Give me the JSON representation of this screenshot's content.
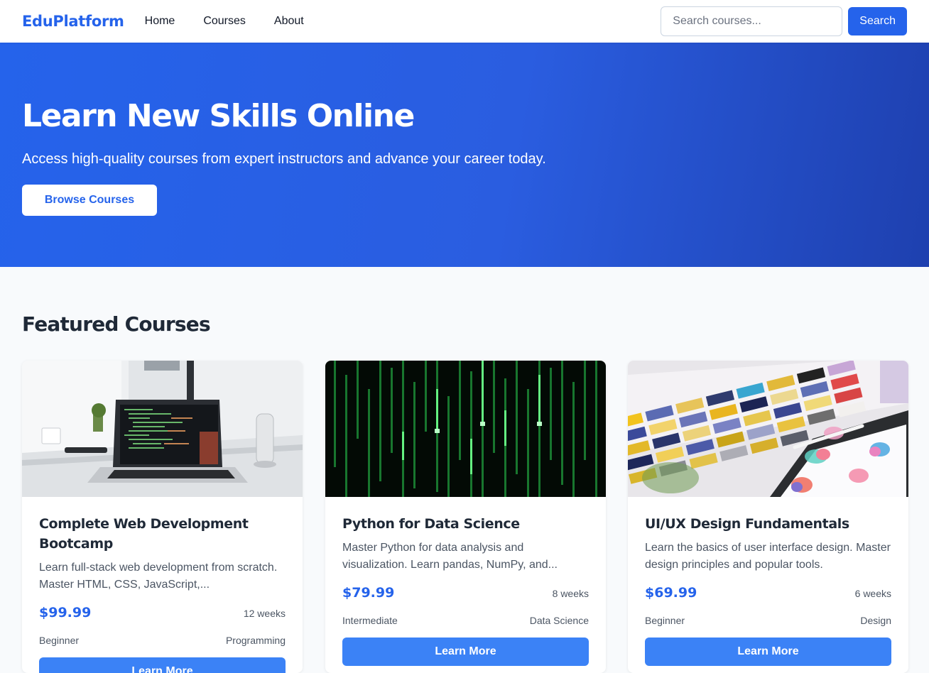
{
  "nav": {
    "logo": "EduPlatform",
    "links": [
      "Home",
      "Courses",
      "About"
    ],
    "search_placeholder": "Search courses...",
    "search_button": "Search"
  },
  "hero": {
    "title": "Learn New Skills Online",
    "subtitle": "Access high-quality courses from expert instructors and advance your career today.",
    "button": "Browse Courses"
  },
  "featured": {
    "title": "Featured Courses",
    "courses": [
      {
        "title": "Complete Web Development Bootcamp",
        "description": "Learn full-stack web development from scratch. Master HTML, CSS, JavaScript,...",
        "price": "$99.99",
        "duration": "12 weeks",
        "level": "Beginner",
        "category": "Programming",
        "button": "Learn More",
        "image": "laptop-code-photo"
      },
      {
        "title": "Python for Data Science",
        "description": "Master Python for data analysis and visualization. Learn pandas, NumPy, and...",
        "price": "$79.99",
        "duration": "8 weeks",
        "level": "Intermediate",
        "category": "Data Science",
        "button": "Learn More",
        "image": "matrix-code-photo"
      },
      {
        "title": "UI/UX Design Fundamentals",
        "description": "Learn the basics of user interface design. Master design principles and popular tools.",
        "price": "$69.99",
        "duration": "6 weeks",
        "level": "Beginner",
        "category": "Design",
        "button": "Learn More",
        "image": "color-swatches-photo"
      }
    ]
  },
  "colors": {
    "accent": "#2563eb",
    "hero_end": "#1e40af",
    "button": "#3b82f6"
  }
}
